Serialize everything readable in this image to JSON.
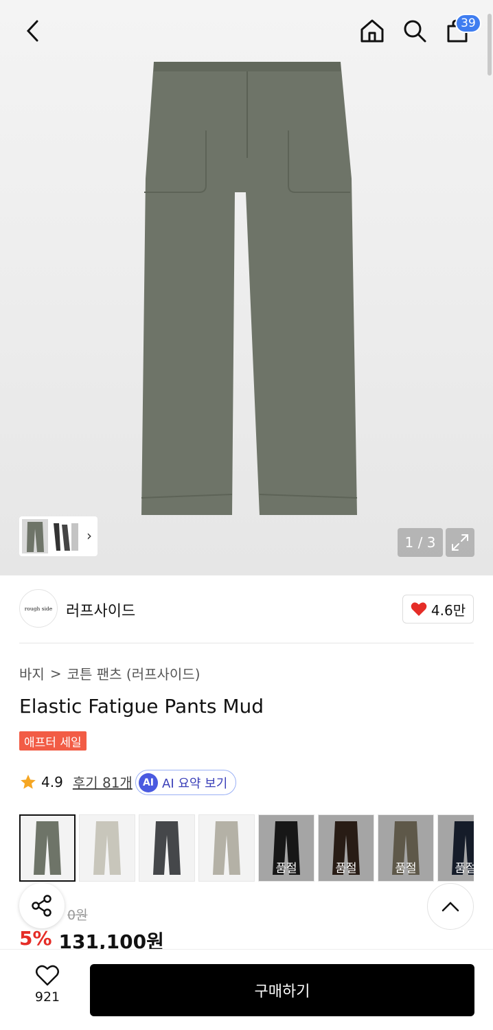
{
  "header": {
    "back_icon": "chevron-left-icon",
    "home_icon": "home-icon",
    "search_icon": "search-icon",
    "cart_icon": "shopping-bag-icon",
    "cart_count": "39"
  },
  "gallery": {
    "counter": "1 / 3",
    "expand_icon": "expand-icon"
  },
  "brand": {
    "logo_text": "rough side",
    "name": "러프사이드",
    "likes": "4.6만"
  },
  "breadcrumb": {
    "category": "바지",
    "separator": ">",
    "subcategory": "코튼 팬츠 (러프사이드)"
  },
  "product": {
    "title": "Elastic Fatigue Pants Mud",
    "badge": "애프터 세일",
    "rating": "4.9",
    "reviews_label": "후기 81개",
    "ai_badge": "AI",
    "ai_summary_label": "AI 요약 보기"
  },
  "swatches": [
    {
      "color": "#6e7468",
      "soldout": false,
      "label": ""
    },
    {
      "color": "#c8c6bb",
      "soldout": false,
      "label": ""
    },
    {
      "color": "#45474a",
      "soldout": false,
      "label": ""
    },
    {
      "color": "#b4b1a6",
      "soldout": false,
      "label": ""
    },
    {
      "color": "#222222",
      "soldout": true,
      "label": "품절"
    },
    {
      "color": "#3b2a20",
      "soldout": true,
      "label": "품절"
    },
    {
      "color": "#8b826c",
      "soldout": true,
      "label": "품절"
    },
    {
      "color": "#1f2a3d",
      "soldout": true,
      "label": "품절"
    }
  ],
  "price": {
    "original": "0원",
    "discount": "5%",
    "final": "131,100원"
  },
  "bottom": {
    "wish_count": "921",
    "buy_label": "구매하기"
  },
  "colors": {
    "accent_blue": "#3f7df0",
    "sale_red": "#e52d27",
    "badge_orange": "#f25c45",
    "product_main": "#6e7468"
  }
}
